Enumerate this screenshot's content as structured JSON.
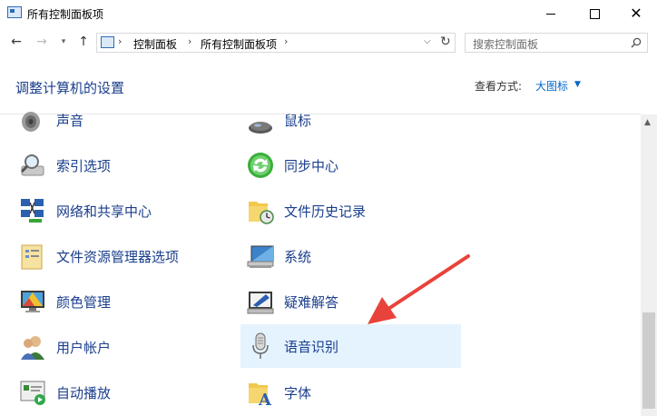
{
  "window": {
    "title": "所有控制面板项",
    "minimize": "–",
    "maximize": "□",
    "close": "✕"
  },
  "nav": {
    "back": "←",
    "forward": "→",
    "recent": "▾",
    "up": "↑",
    "breadcrumb": [
      "控制面板",
      "所有控制面板项"
    ],
    "sep": "›",
    "dropdown": "⌵",
    "refresh": "↻",
    "search_placeholder": "搜索控制面板"
  },
  "header": {
    "title": "调整计算机的设置",
    "view_by_label": "查看方式:",
    "view_by_value": "大图标",
    "view_by_arrow": "▼"
  },
  "items": {
    "sound": "声音",
    "mouse": "鼠标",
    "indexing": "索引选项",
    "sync": "同步中心",
    "network": "网络和共享中心",
    "file_history": "文件历史记录",
    "explorer_options": "文件资源管理器选项",
    "system": "系统",
    "color_mgmt": "颜色管理",
    "troubleshooting": "疑难解答",
    "user_accounts": "用户帐户",
    "speech": "语音识别",
    "autoplay": "自动播放",
    "fonts": "字体"
  },
  "colors": {
    "link": "#1a3e8c",
    "selected_bg": "#e5f3ff",
    "accent_arrow": "#e8433a"
  }
}
